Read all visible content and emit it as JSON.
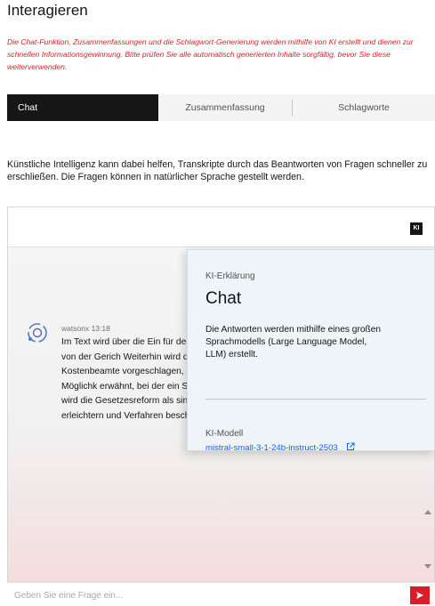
{
  "section": {
    "title": "Interagieren",
    "disclaimer": "Die Chat-Funktion, Zusammenfassungen und die Schlagwort-Generierung werden mithilfe von KI erstellt und dienen zur schnellen Informationsgewinnung. Bitte prüfen Sie alle automatisch generierten Inhalte sorgfältig, bevor Sie diese weiterverwenden."
  },
  "tabs": [
    {
      "label": "Chat",
      "active": true
    },
    {
      "label": "Zusammenfassung",
      "active": false
    },
    {
      "label": "Schlagworte",
      "active": false
    }
  ],
  "intro": "Künstliche Intelligenz kann dabei helfen, Transkripte durch das Beantworten von Fragen schneller zu erschließen. Die Fragen können in natürlicher Sprache gestellt werden.",
  "chat": {
    "ki_badge": "KI",
    "message": {
      "sender": "watsonx",
      "time": "13:18",
      "text": "Im Text wird über die Ein für den Kostenvorschuss auch die aktuelle Praxis b Rechnung von der Gerich Weiterhin wird die Proble Verfahrens thematisiert, diese von Kostenbeamte vorgeschlagen, dass eine wäre, jedoch auch eine n Zudem wird die Möglichk erwähnt, bei der ein Syste Kosten ungewöhnlich erscheinen. Abschließend wird die Gesetzesreform als sinnvoll angesehen, da sie den Zugang zum Recht erleichtern und Verfahren beschleunigen kann, jedoch nicht"
    },
    "input_placeholder": "Geben Sie eine Frage ein...",
    "send_icon": "send-icon"
  },
  "ki_popover": {
    "kicker": "KI-Erklärung",
    "title": "Chat",
    "body": "Die Antworten werden mithilfe eines großen Sprachmodells (Large Language Model, LLM) erstellt.",
    "model_label": "KI-Modell",
    "model_name": "mistral-small-3-1-24b-instruct-2503"
  },
  "colors": {
    "accent_red": "#da1e28",
    "link_blue": "#0f62fe",
    "dark": "#161616"
  }
}
